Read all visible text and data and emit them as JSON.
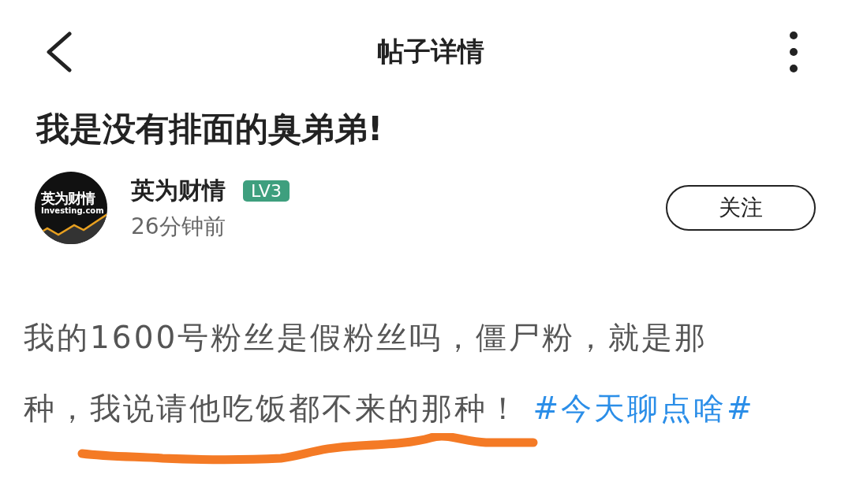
{
  "header": {
    "title": "帖子详情"
  },
  "post": {
    "title": "我是没有排面的臭弟弟!",
    "author": {
      "name": "英为财情",
      "level": "LV3",
      "time": "26分钟前",
      "logo_text": "英为财情",
      "logo_sub": "Investing.com"
    },
    "follow": {
      "label": "关注",
      "selected": false
    },
    "body_lines": [
      "我的1600号粉丝是假粉丝吗，僵尸粉，就是那",
      "种，我说请他吃饭都不来的那种！"
    ],
    "hashtag": "#今天聊点啥#"
  }
}
